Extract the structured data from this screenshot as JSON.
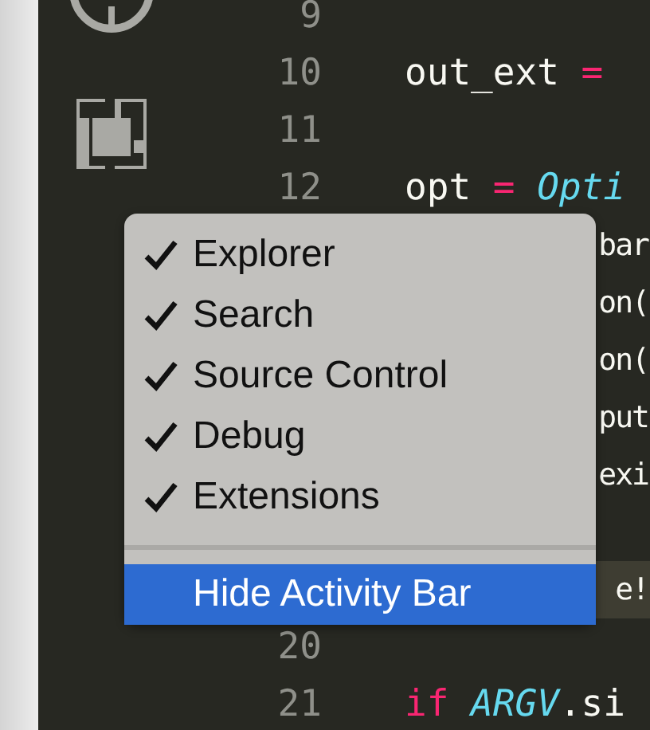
{
  "activity_bar": {
    "icons": [
      {
        "kind": "circle"
      },
      {
        "kind": "extensions"
      }
    ]
  },
  "editor": {
    "lines": [
      {
        "number": "9"
      },
      {
        "number": "10",
        "tokens": [
          {
            "kind": "plain",
            "text": "out_ext "
          },
          {
            "kind": "op",
            "text": "="
          }
        ]
      },
      {
        "number": "11"
      },
      {
        "number": "12",
        "tokens": [
          {
            "kind": "plain",
            "text": "opt "
          },
          {
            "kind": "op",
            "text": "= "
          },
          {
            "kind": "class",
            "text": "Opti"
          }
        ]
      },
      {
        "tail": "bar",
        "highlighted": false
      },
      {
        "tail": "on(",
        "highlighted": false
      },
      {
        "tail": "on(",
        "highlighted": false
      },
      {
        "tail": "put",
        "highlighted": false
      },
      {
        "tail": "exi",
        "highlighted": false
      },
      {
        "highlighted": false
      },
      {
        "tail": "e!",
        "highlighted": true
      },
      {
        "number": "20"
      },
      {
        "number": "21",
        "tokens": [
          {
            "kind": "keyword",
            "text": "if "
          },
          {
            "kind": "class",
            "text": "ARGV"
          },
          {
            "kind": "plain",
            "text": ".si"
          }
        ]
      }
    ]
  },
  "context_menu": {
    "items": [
      {
        "kind": "check",
        "label": "Explorer",
        "checked": true
      },
      {
        "kind": "check",
        "label": "Search",
        "checked": true
      },
      {
        "kind": "check",
        "label": "Source Control",
        "checked": true
      },
      {
        "kind": "check",
        "label": "Debug",
        "checked": true
      },
      {
        "kind": "check",
        "label": "Extensions",
        "checked": true
      },
      {
        "kind": "separator"
      },
      {
        "kind": "action",
        "label": "Hide Activity Bar",
        "selected": true
      }
    ]
  }
}
